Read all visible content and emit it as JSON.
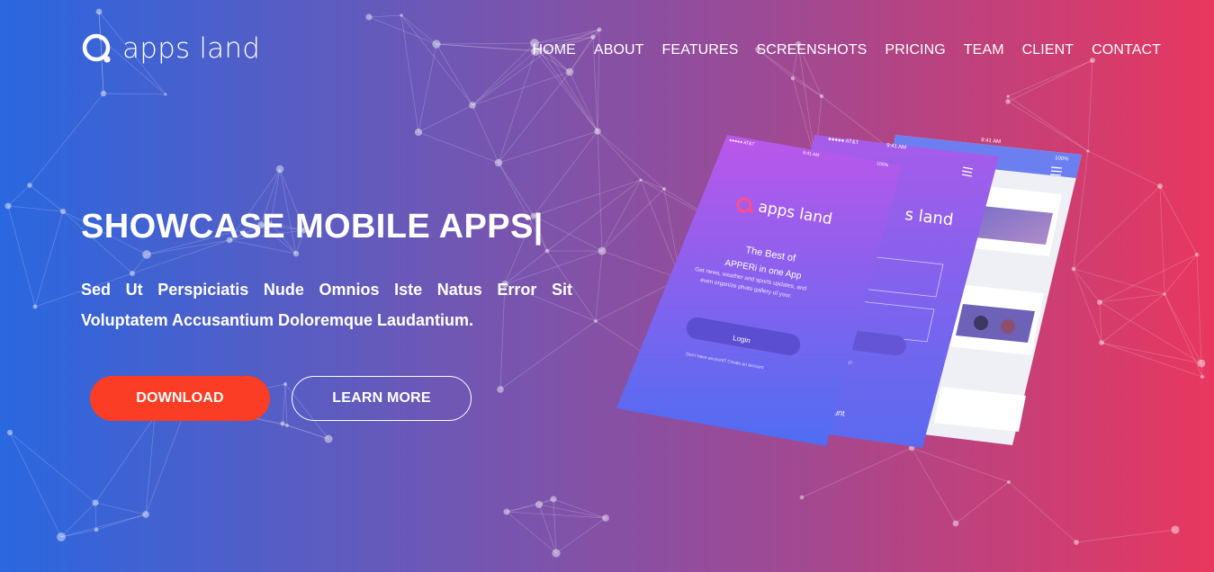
{
  "brand": {
    "name": "apps land",
    "icon": "apps-land-logo-icon"
  },
  "nav": {
    "items": [
      "HOME",
      "ABOUT",
      "FEATURES",
      "SCREENSHOTS",
      "PRICING",
      "TEAM",
      "CLIENT",
      "CONTACT"
    ]
  },
  "hero": {
    "title": "SHOWCASE MOBILE APPS|",
    "subtitle": "Sed Ut Perspiciatis Nude Omnios Iste Natus Error Sit Voluptatem Accusantium Doloremque Laudantium.",
    "download_label": "DOWNLOAD",
    "learn_more_label": "LEARN MORE"
  },
  "mockup": {
    "status_left": "●●●●● AT&T",
    "status_time": "9:41 AM",
    "status_right": "100%",
    "app_name": "apps land",
    "tagline_line1": "The Best of",
    "tagline_line2": "APPERi in one App",
    "desc_line1": "Get news, weather and sports updates, and",
    "desc_line2": "even organize photo gallery of your.",
    "login_label": "Login",
    "signup_text": "Don't have account? Create an account",
    "back_login_label": "n",
    "back_forgot": "ssword?",
    "back_account": "y account",
    "back_brand": "s land"
  },
  "colors": {
    "gradient_start": "#2a67e0",
    "gradient_end": "#e8375f",
    "download_button": "#fb3d25",
    "phone_top": "#b85ae8",
    "phone_bottom": "#4f6bf0"
  }
}
